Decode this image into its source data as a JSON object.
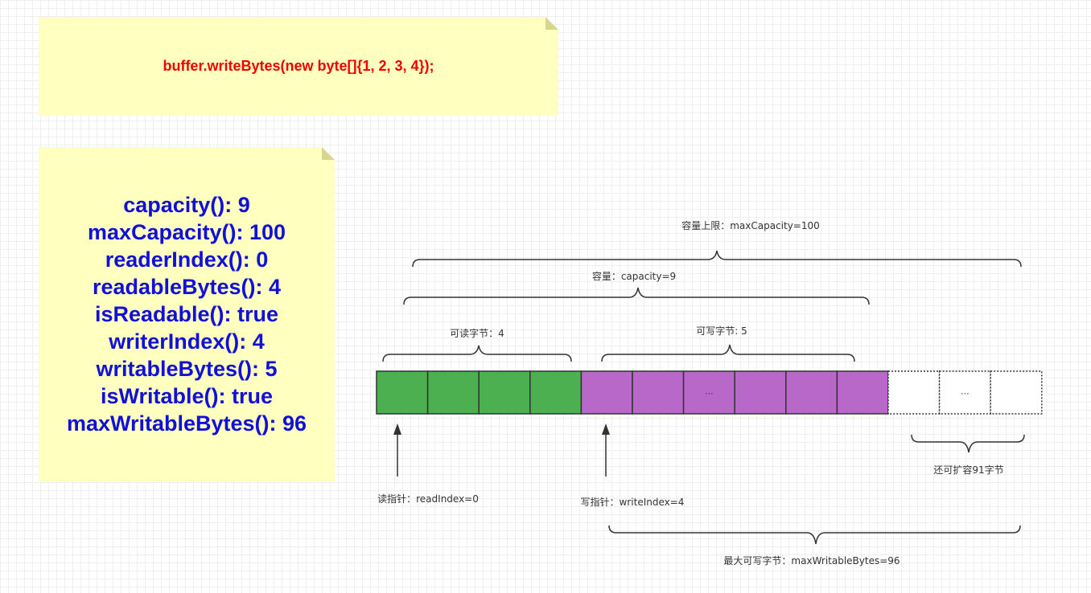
{
  "code_note": {
    "text": "buffer.writeBytes(new byte[]{1, 2, 3, 4});"
  },
  "stats_note": {
    "lines": [
      "capacity(): 9",
      "maxCapacity(): 100",
      "readerIndex(): 0",
      "readableBytes(): 4",
      "isReadable(): true",
      "writerIndex(): 4",
      "writableBytes(): 5",
      "isWritable(): true",
      "maxWritableBytes(): 96"
    ]
  },
  "diagram": {
    "max_capacity_label": "容量上限：maxCapacity=100",
    "capacity_label": "容量：capacity=9",
    "readable_label": "可读字节：4",
    "writable_label": "可写字节: 5",
    "expandable_label": "还可扩容91字节",
    "read_pointer_label": "读指针：readIndex=0",
    "write_pointer_label": "写指针：writeIndex=4",
    "max_writable_label": "最大可写字节：maxWritableBytes=96",
    "cells": [
      {
        "state": "readable",
        "text": ""
      },
      {
        "state": "readable",
        "text": ""
      },
      {
        "state": "readable",
        "text": ""
      },
      {
        "state": "readable",
        "text": ""
      },
      {
        "state": "writable",
        "text": ""
      },
      {
        "state": "writable",
        "text": ""
      },
      {
        "state": "writable",
        "text": "..."
      },
      {
        "state": "writable",
        "text": ""
      },
      {
        "state": "writable",
        "text": ""
      },
      {
        "state": "writable",
        "text": ""
      },
      {
        "state": "expandable",
        "text": ""
      },
      {
        "state": "expandable",
        "text": "..."
      },
      {
        "state": "expandable",
        "text": ""
      }
    ],
    "colors": {
      "readable": "#4caf50",
      "writable": "#b768c9",
      "expandable": "#ffffff",
      "note_bg": "#ffffc0",
      "code_text": "#ee0000",
      "stats_text": "#1010d8"
    }
  }
}
